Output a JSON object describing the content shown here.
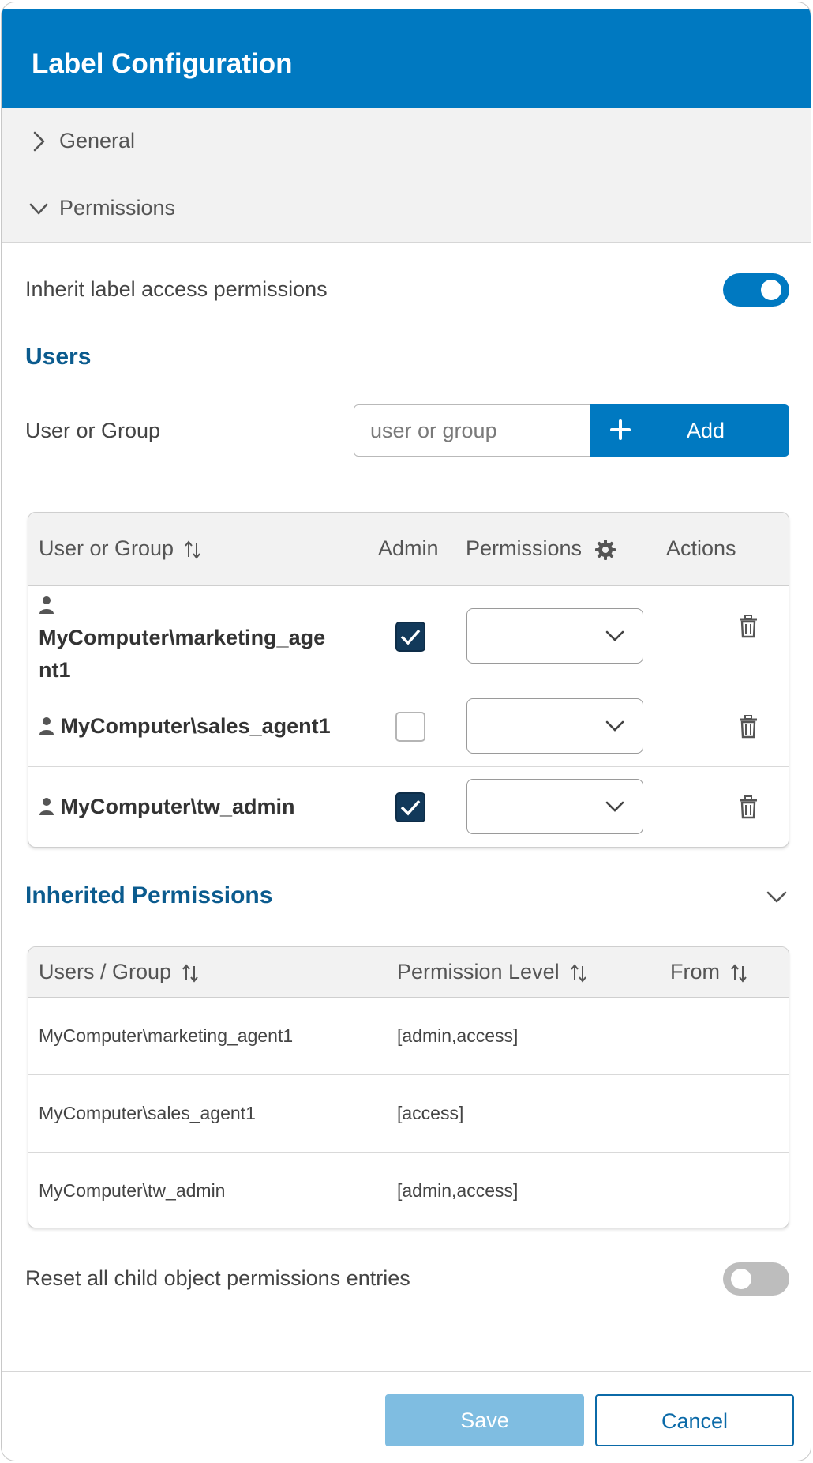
{
  "header": {
    "title": "Label Configuration"
  },
  "sections": {
    "general": {
      "label": "General",
      "expanded": false
    },
    "permissions": {
      "label": "Permissions",
      "expanded": true
    }
  },
  "inherit_toggle": {
    "label": "Inherit label access permissions",
    "on": true
  },
  "users": {
    "heading": "Users",
    "field_label": "User or Group",
    "input_placeholder": "user or group",
    "input_value": "",
    "add_label": "Add",
    "columns": {
      "user": "User or Group",
      "admin": "Admin",
      "permissions": "Permissions",
      "actions": "Actions"
    },
    "rows": [
      {
        "name_line1": "MyComputer\\marketing_age",
        "name_line2": "nt1",
        "admin": true,
        "permission": ""
      },
      {
        "name": "MyComputer\\sales_agent1",
        "admin": false,
        "permission": ""
      },
      {
        "name": "MyComputer\\tw_admin",
        "admin": true,
        "permission": ""
      }
    ]
  },
  "inherited": {
    "heading": "Inherited Permissions",
    "columns": {
      "user": "Users / Group",
      "level": "Permission Level",
      "from": "From"
    },
    "rows": [
      {
        "user": "MyComputer\\marketing_agent1",
        "level": "[admin,access]",
        "from": ""
      },
      {
        "user": "MyComputer\\sales_agent1",
        "level": "[access]",
        "from": ""
      },
      {
        "user": "MyComputer\\tw_admin",
        "level": "[admin,access]",
        "from": ""
      }
    ]
  },
  "reset_toggle": {
    "label": "Reset all child object permissions entries",
    "on": false
  },
  "footer": {
    "save_label": "Save",
    "cancel_label": "Cancel",
    "save_enabled": false
  },
  "colors": {
    "primary": "#0079c1",
    "heading": "#0b5b8e",
    "checkbox_checked": "#12395a",
    "save_disabled": "#7fbde1",
    "toggle_off": "#bdbdbd"
  }
}
